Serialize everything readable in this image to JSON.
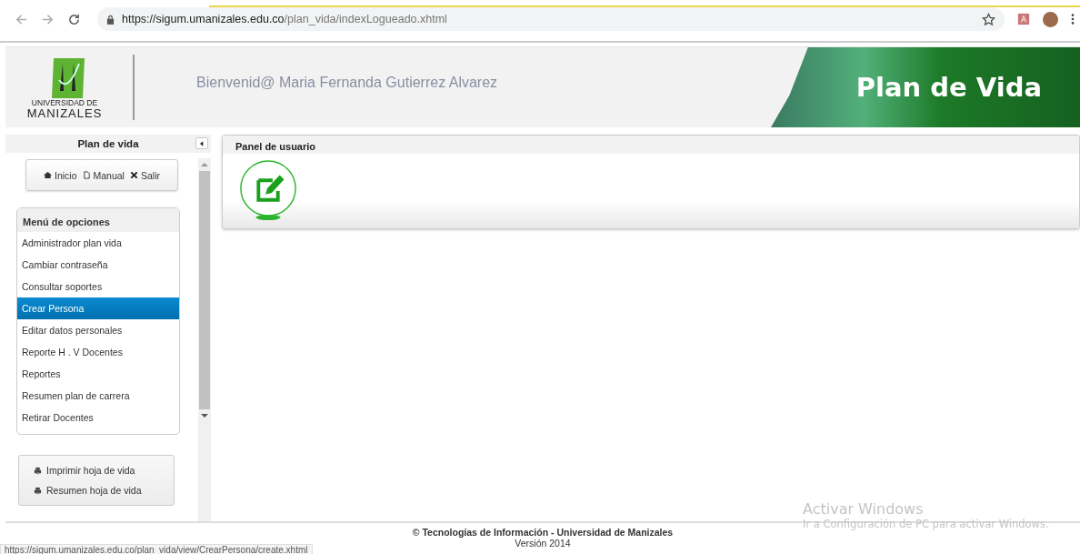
{
  "browser": {
    "url_host": "https://sigum.umanizales.edu.co",
    "url_path": "/plan_vida/indexLogueado.xhtml"
  },
  "header": {
    "logo_line_1": "UNIVERSIDAD DE",
    "logo_line_2": "MANIZALES",
    "welcome": "Bienvenid@ Maria Fernanda Gutierrez Alvarez",
    "banner_title": "Plan de Vida"
  },
  "sidebar": {
    "title": "Plan de vida",
    "toolbar": [
      {
        "kind": "home",
        "label": "Inicio"
      },
      {
        "kind": "document",
        "label": "Manual"
      },
      {
        "kind": "close",
        "label": "Salir"
      }
    ],
    "menu": {
      "title": "Menú de opciones",
      "items": [
        {
          "label": "Administrador plan vida",
          "selected": false
        },
        {
          "label": "Cambiar contraseña",
          "selected": false
        },
        {
          "label": "Consultar soportes",
          "selected": false
        },
        {
          "label": "Crear Persona",
          "selected": true
        },
        {
          "label": "Editar datos personales",
          "selected": false
        },
        {
          "label": "Reporte H . V Docentes",
          "selected": false
        },
        {
          "label": "Reportes",
          "selected": false
        },
        {
          "label": "Resumen plan de carrera",
          "selected": false
        },
        {
          "label": "Retirar Docentes",
          "selected": false
        }
      ]
    },
    "print_links": [
      "Imprimir hoja de vida",
      "Resumen hoja de vida"
    ]
  },
  "panel": {
    "title": "Panel de usuario"
  },
  "footer": {
    "copyright": "© Tecnologías de Información - Universidad de Manizales",
    "version": "Versión 2014"
  },
  "os_notice": {
    "title": "Activar Windows",
    "text": "Ir a Configuración de PC para activar Windows."
  },
  "status_link": "https://sigum.umanizales.edu.co/plan_vida/view/CrearPersona/create.xhtml"
}
